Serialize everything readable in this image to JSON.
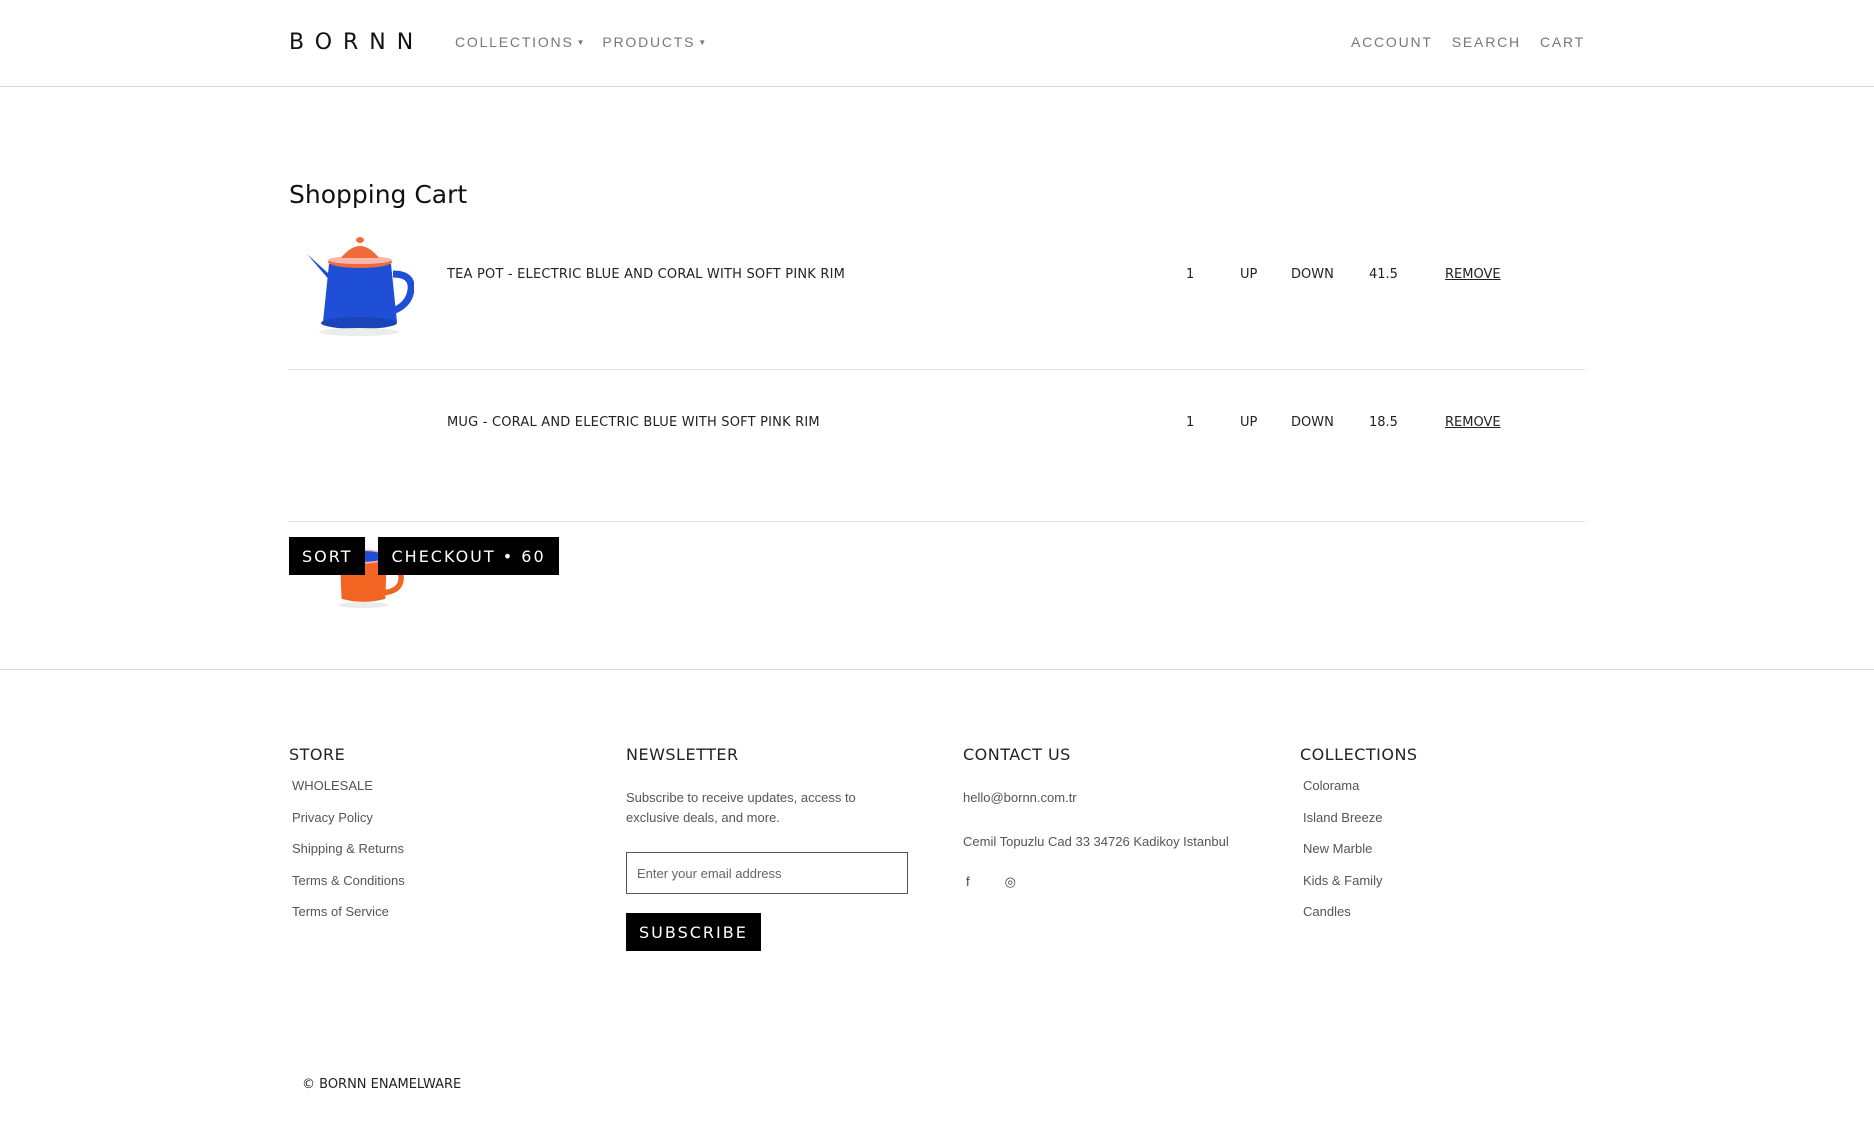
{
  "header": {
    "logo": "BORNN",
    "nav_left": [
      {
        "label": "COLLECTIONS",
        "dropdown": true
      },
      {
        "label": "PRODUCTS",
        "dropdown": true
      }
    ],
    "nav_right": [
      {
        "label": "ACCOUNT"
      },
      {
        "label": "SEARCH"
      },
      {
        "label": "CART"
      }
    ]
  },
  "cart": {
    "title": "Shopping Cart",
    "items": [
      {
        "name": "TEA POT - ELECTRIC BLUE AND CORAL WITH SOFT PINK RIM",
        "qty": "1",
        "up": "UP",
        "down": "DOWN",
        "price": "41.5",
        "remove": "REMOVE",
        "image_icon": "teapot-icon"
      },
      {
        "name": "MUG - CORAL AND ELECTRIC BLUE WITH SOFT PINK RIM",
        "qty": "1",
        "up": "UP",
        "down": "DOWN",
        "price": "18.5",
        "remove": "REMOVE",
        "image_icon": "mug-icon"
      }
    ],
    "sort_label": "SORT",
    "checkout_label": "CHECKOUT • 60"
  },
  "footer": {
    "store": {
      "title": "STORE",
      "links": [
        "WHOLESALE",
        "Privacy Policy",
        "Shipping & Returns",
        "Terms & Conditions",
        "Terms of Service"
      ]
    },
    "newsletter": {
      "title": "NEWSLETTER",
      "text": "Subscribe to receive updates, access to exclusive deals, and more.",
      "placeholder": "Enter your email address",
      "button": "SUBSCRIBE"
    },
    "contact": {
      "title": "CONTACT US",
      "email": "hello@bornn.com.tr",
      "address": "Cemil Topuzlu Cad 33 34726 Kadikoy Istanbul",
      "social": [
        {
          "icon": "facebook-icon",
          "glyph": "f"
        },
        {
          "icon": "instagram-icon",
          "glyph": "◎"
        }
      ]
    },
    "collections": {
      "title": "COLLECTIONS",
      "links": [
        "Colorama",
        "Island Breeze",
        "New Marble",
        "Kids & Family",
        "Candles"
      ]
    },
    "copyright": "© BORNN ENAMELWARE"
  },
  "colors": {
    "teapot_body": "#1e4fd6",
    "teapot_lid": "#f06a3a",
    "mug_body": "#f26422",
    "mug_inner": "#1e4fd6",
    "rim": "#f7b8b0"
  }
}
